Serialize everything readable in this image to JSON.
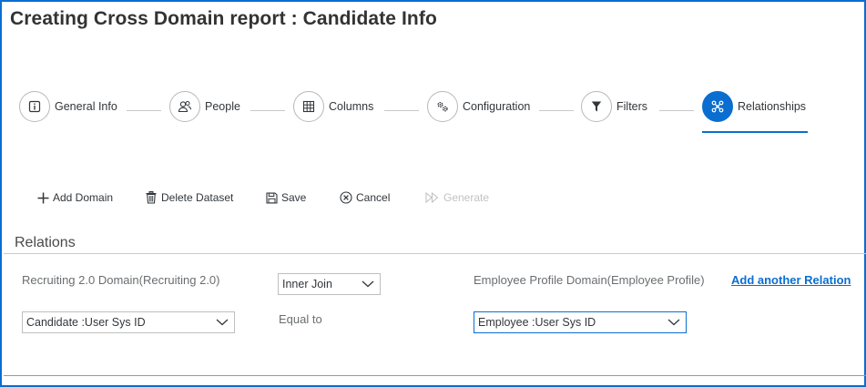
{
  "page": {
    "title": "Creating Cross Domain report : Candidate Info"
  },
  "wizard": {
    "steps": [
      {
        "label": "General Info",
        "icon": "info-icon"
      },
      {
        "label": "People",
        "icon": "people-icon"
      },
      {
        "label": "Columns",
        "icon": "columns-icon"
      },
      {
        "label": "Configuration",
        "icon": "configuration-gears-icon"
      },
      {
        "label": "Filters",
        "icon": "filter-icon"
      },
      {
        "label": "Relationships",
        "icon": "relationships-icon"
      }
    ],
    "active_step": "Relationships"
  },
  "toolbar": {
    "add_domain": "Add Domain",
    "delete_dataset": "Delete Dataset",
    "save": "Save",
    "cancel": "Cancel",
    "generate": "Generate"
  },
  "relations": {
    "title": "Relations",
    "left_domain": "Recruiting 2.0 Domain(Recruiting 2.0)",
    "join_type": "Inner Join",
    "right_domain": "Employee Profile Domain(Employee Profile)",
    "add_relation": "Add another Relation",
    "left_field": "Candidate :User Sys ID",
    "operator": "Equal to",
    "right_field": "Employee :User Sys ID"
  },
  "colors": {
    "accent": "#0a6ed1",
    "disabled": "#c2c2c2",
    "border": "#bfbfbf"
  }
}
